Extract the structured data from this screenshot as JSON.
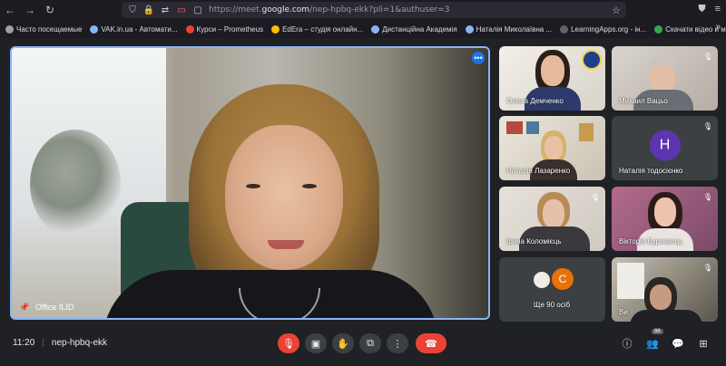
{
  "browser": {
    "url_prefix": "https://meet.",
    "url_domain": "google.com",
    "url_rest": "/nep-hpbq-ekk?pli=1&authuser=3",
    "bookmarks": [
      {
        "label": "Часто посещаемые",
        "color": "#9aa0a6"
      },
      {
        "label": "VAK.in.ua - Автомати...",
        "color": "#8ab4f8"
      },
      {
        "label": "Курси – Prometheus",
        "color": "#ea4335"
      },
      {
        "label": "EdEra – студія онлайн...",
        "color": "#fbbc04"
      },
      {
        "label": "Дистанційна Академія",
        "color": "#8ab4f8"
      },
      {
        "label": "Наталія Миколаївна ...",
        "color": "#8ab4f8"
      },
      {
        "label": "LearningApps.org - ін...",
        "color": "#5f6368"
      },
      {
        "label": "Скачати відео и музи...",
        "color": "#34a853"
      }
    ],
    "more": "»"
  },
  "main": {
    "speaker_name": "Office ILID",
    "more": "•••"
  },
  "tiles": [
    {
      "name": "Олена Демченко"
    },
    {
      "name": "Михаил Вацьо"
    },
    {
      "name": "Наталія Лазаренко"
    },
    {
      "name": "Наталія тодосієнко",
      "initial": "Н",
      "avatar_color": "#5e35b1"
    },
    {
      "name": "Ірина Коломієць"
    },
    {
      "name": "Вікторія Буркевець"
    },
    {
      "name": "Ще 90 осіб",
      "initial": "С",
      "avatar_color": "#e8710a"
    },
    {
      "name": "Ви"
    }
  ],
  "bottom": {
    "time": "11:20",
    "separator": "|",
    "meeting_code": "nep-hpbq-ekk",
    "participants_badge": "98"
  }
}
